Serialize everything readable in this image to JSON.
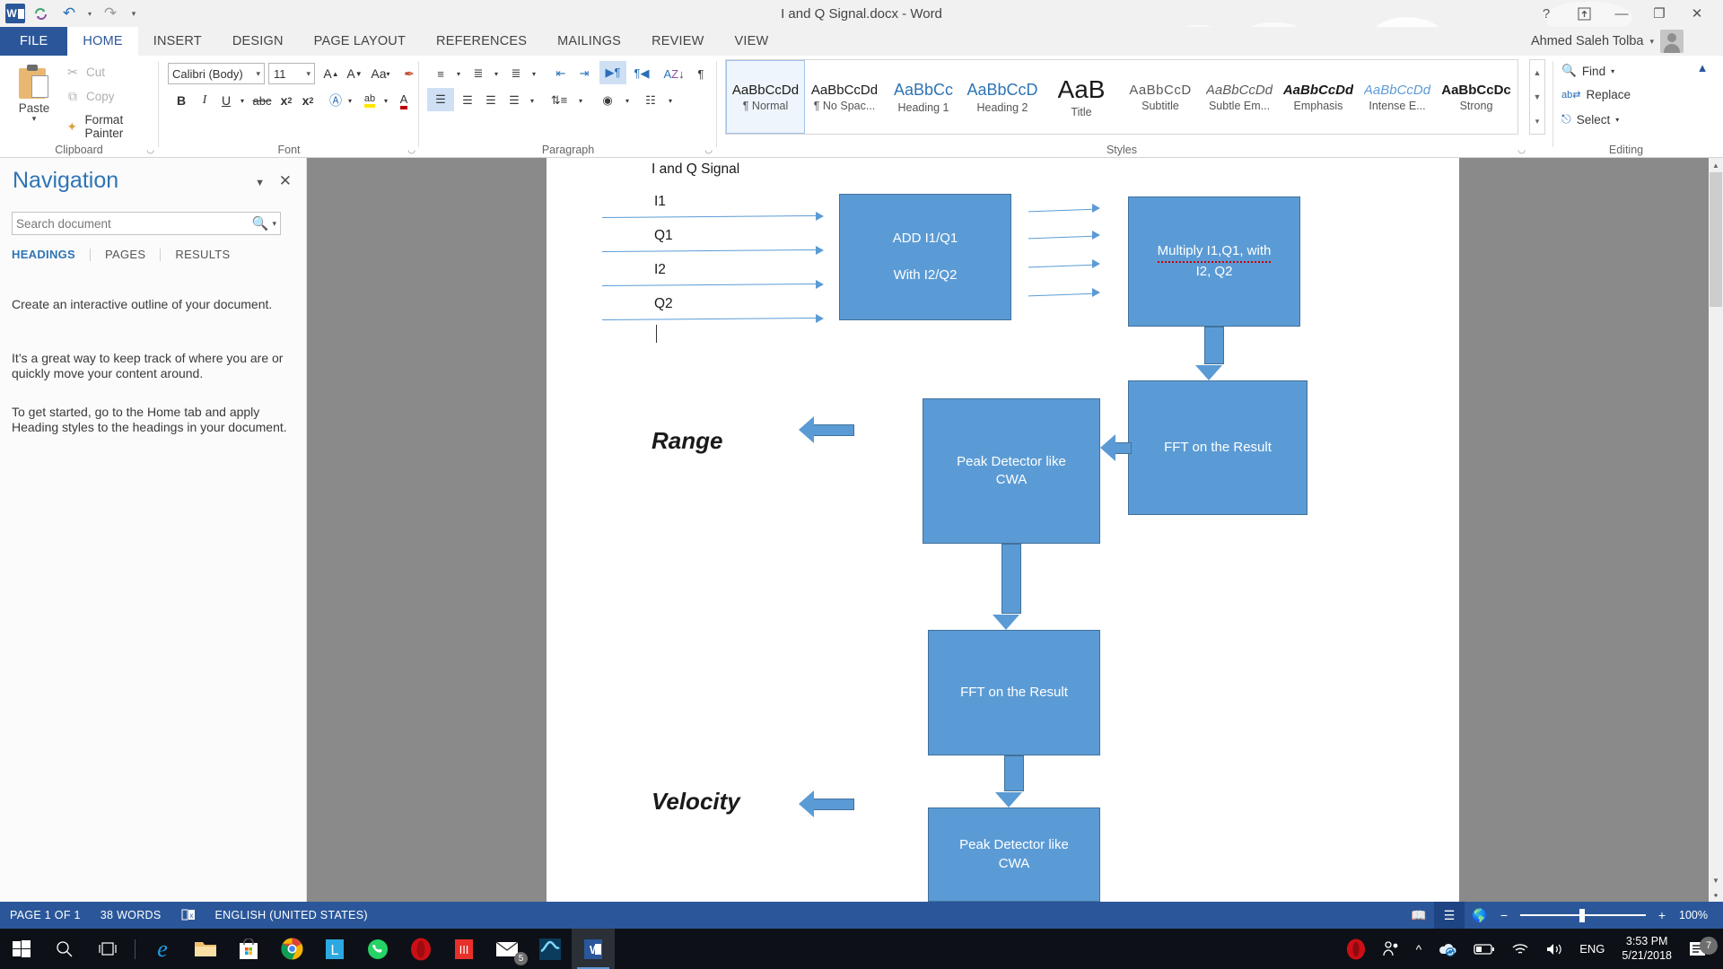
{
  "titlebar": {
    "document_title": "I and Q Signal.docx - Word",
    "quick_access": [
      {
        "name": "word-logo",
        "glyph": "W"
      },
      {
        "name": "save-icon",
        "glyph": "↻"
      },
      {
        "name": "undo-icon",
        "glyph": "↶"
      },
      {
        "name": "redo-icon",
        "glyph": "↻"
      },
      {
        "name": "customize-qat-icon",
        "glyph": "▾"
      }
    ],
    "window_controls": [
      {
        "name": "help",
        "glyph": "?"
      },
      {
        "name": "ribbon-display-options",
        "glyph": "⬆"
      },
      {
        "name": "minimize",
        "glyph": "—"
      },
      {
        "name": "restore",
        "glyph": "❐"
      },
      {
        "name": "close",
        "glyph": "✕"
      }
    ]
  },
  "ribbon": {
    "tabs": [
      {
        "label": "FILE",
        "state": "file"
      },
      {
        "label": "HOME",
        "state": "active"
      },
      {
        "label": "INSERT",
        "state": "normal"
      },
      {
        "label": "DESIGN",
        "state": "normal"
      },
      {
        "label": "PAGE LAYOUT",
        "state": "normal"
      },
      {
        "label": "REFERENCES",
        "state": "normal"
      },
      {
        "label": "MAILINGS",
        "state": "normal"
      },
      {
        "label": "REVIEW",
        "state": "normal"
      },
      {
        "label": "VIEW",
        "state": "normal"
      }
    ],
    "user_name": "Ahmed Saleh Tolba",
    "collapse_glyph": "▴",
    "groups": {
      "clipboard": {
        "label": "Clipboard",
        "paste_label": "Paste",
        "items": [
          {
            "label": "Cut",
            "icon": "scissors-icon",
            "glyph": "✂"
          },
          {
            "label": "Copy",
            "icon": "copy-icon",
            "glyph": "⧉"
          },
          {
            "label": "Format Painter",
            "icon": "format-painter-icon",
            "glyph": "🖌"
          }
        ]
      },
      "font": {
        "label": "Font",
        "font_name": "Calibri (Body)",
        "font_size": "11",
        "buttons_row1": [
          "A▴",
          "A▾",
          "Aa",
          "✐"
        ],
        "buttons_row2": [
          "B",
          "I",
          "U",
          "abc",
          "x₂",
          "x²",
          "A",
          "ab",
          "A"
        ]
      },
      "paragraph": {
        "label": "Paragraph"
      },
      "styles": {
        "label": "Styles",
        "items": [
          {
            "sample": "AaBbCcDd",
            "name": "¶ Normal",
            "kind": "normal",
            "selected": true
          },
          {
            "sample": "AaBbCcDd",
            "name": "¶ No Spac...",
            "kind": "nospace",
            "selected": false
          },
          {
            "sample": "AaBbCc",
            "name": "Heading 1",
            "kind": "h1",
            "selected": false
          },
          {
            "sample": "AaBbCcD",
            "name": "Heading 2",
            "kind": "h2",
            "selected": false
          },
          {
            "sample": "AaB",
            "name": "Title",
            "kind": "title",
            "selected": false
          },
          {
            "sample": "AaBbCcD",
            "name": "Subtitle",
            "kind": "subtitle",
            "selected": false
          },
          {
            "sample": "AaBbCcDd",
            "name": "Subtle Em...",
            "kind": "subtle",
            "selected": false
          },
          {
            "sample": "AaBbCcDd",
            "name": "Emphasis",
            "kind": "emph",
            "selected": false
          },
          {
            "sample": "AaBbCcDd",
            "name": "Intense E...",
            "kind": "intense",
            "selected": false
          },
          {
            "sample": "AaBbCcDc",
            "name": "Strong",
            "kind": "strong",
            "selected": false
          }
        ]
      },
      "editing": {
        "label": "Editing",
        "items": [
          {
            "label": "Find",
            "icon": "binoculars-icon",
            "glyph": "🔍",
            "caret": "▾"
          },
          {
            "label": "Replace",
            "icon": "replace-icon",
            "glyph": "ab↔",
            "caret": ""
          },
          {
            "label": "Select",
            "icon": "select-icon",
            "glyph": "↖",
            "caret": "▾"
          }
        ]
      }
    }
  },
  "navigation": {
    "title": "Navigation",
    "search_placeholder": "Search document",
    "tabs": [
      {
        "label": "HEADINGS",
        "active": true
      },
      {
        "label": "PAGES",
        "active": false
      },
      {
        "label": "RESULTS",
        "active": false
      }
    ],
    "paragraphs": [
      "Create an interactive outline of your document.",
      "It’s a great way to keep track of where you are or quickly move your content around.",
      "To get started, go to the Home tab and apply Heading styles to the headings in your document."
    ]
  },
  "document": {
    "heading": "I and Q Signal",
    "input_labels": [
      "I1",
      "Q1",
      "I2",
      "Q2"
    ],
    "boxes": [
      {
        "id": "add",
        "lines": [
          "ADD I1/Q1",
          "With I2/Q2"
        ]
      },
      {
        "id": "multiply",
        "lines": [
          "Multiply I1,Q1, with",
          "I2, Q2"
        ]
      },
      {
        "id": "fft1",
        "lines": [
          "FFT on the Result"
        ]
      },
      {
        "id": "peak1",
        "lines": [
          "Peak Detector like",
          "CWA"
        ]
      },
      {
        "id": "fft2",
        "lines": [
          "FFT on the Result"
        ]
      },
      {
        "id": "peak2",
        "lines": [
          "Peak Detector like",
          "CWA"
        ]
      }
    ],
    "outputs": [
      {
        "id": "range",
        "label": "Range"
      },
      {
        "id": "velocity",
        "label": "Velocity"
      }
    ],
    "accent_color": "#5b9bd5",
    "accent_border_color": "#41719c"
  },
  "statusbar": {
    "page": "PAGE 1 OF 1",
    "words": "38 WORDS",
    "proofing_icon": "proofing-errors-icon",
    "language": "ENGLISH (UNITED STATES)",
    "views": [
      {
        "name": "read-mode-view-button",
        "glyph": "📖",
        "active": false
      },
      {
        "name": "print-layout-view-button",
        "glyph": "☰",
        "active": true
      },
      {
        "name": "web-layout-view-button",
        "glyph": "🌐",
        "active": false
      }
    ],
    "zoom_out": "−",
    "zoom_in": "+",
    "zoom_level": "100%"
  },
  "taskbar": {
    "start_glyph": "⊞",
    "search_glyph": "⚲",
    "taskview_glyph": "❐",
    "apps": [
      {
        "name": "edge-taskbar-icon",
        "glyph": "e"
      },
      {
        "name": "file-explorer-taskbar-icon",
        "glyph": "🗀"
      },
      {
        "name": "microsoft-store-taskbar-icon",
        "glyph": "🛍"
      },
      {
        "name": "chrome-taskbar-icon",
        "glyph": "◎"
      },
      {
        "name": "lightshot-taskbar-icon",
        "glyph": "L"
      },
      {
        "name": "whatsapp-taskbar-icon",
        "glyph": "✆"
      },
      {
        "name": "opera-taskbar-icon",
        "glyph": "O"
      },
      {
        "name": "iii-taskbar-icon",
        "glyph": "III"
      },
      {
        "name": "mail-taskbar-icon",
        "glyph": "✉",
        "badge": "5"
      },
      {
        "name": "matlab-taskbar-icon",
        "glyph": "✦"
      },
      {
        "name": "word-taskbar-icon",
        "glyph": "W",
        "active": true
      }
    ],
    "tray": [
      {
        "name": "opera-tray-icon",
        "glyph": "O"
      },
      {
        "name": "people-tray-icon",
        "glyph": "⚹"
      },
      {
        "name": "show-hidden-icons-icon",
        "glyph": "∧"
      },
      {
        "name": "onedrive-tray-icon",
        "glyph": "☁"
      },
      {
        "name": "battery-tray-icon",
        "glyph": "▭"
      },
      {
        "name": "wifi-tray-icon",
        "glyph": "◠"
      },
      {
        "name": "volume-tray-icon",
        "glyph": "🔊"
      },
      {
        "name": "language-tray-indicator",
        "glyph": "ENG"
      }
    ],
    "clock_time": "3:53 PM",
    "clock_date": "5/21/2018",
    "notification_count": "7"
  }
}
